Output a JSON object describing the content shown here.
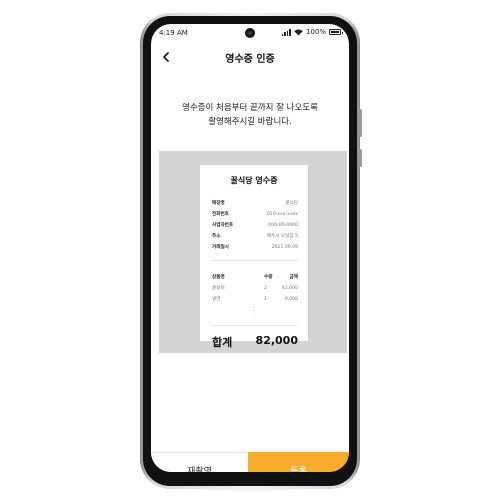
{
  "status_bar": {
    "time": "4:19 AM",
    "battery": "100%"
  },
  "header": {
    "title": "영수증 인증"
  },
  "instruction": {
    "line1": "영수증이 처음부터 끝까지 잘 나오도록",
    "line2": "촬영해주시길 바랍니다."
  },
  "receipt": {
    "title": "꿀식당 영수증",
    "info": [
      {
        "label": "매장명",
        "value": "꿀식당"
      },
      {
        "label": "전화번호",
        "value": "010-xxx-xxxx"
      },
      {
        "label": "사업자번호",
        "value": "000-00-0000"
      },
      {
        "label": "주소",
        "value": "제주시 오일장 5"
      },
      {
        "label": "거래일시",
        "value": "2021.09.09"
      }
    ],
    "columns": [
      "상품명",
      "수량",
      "금액"
    ],
    "items": [
      {
        "name": "꿀갈비",
        "qty": "2",
        "price": "42,000"
      },
      {
        "name": "냉면",
        "qty": "1",
        "price": "9,000"
      }
    ],
    "total_label": "합계",
    "total_value": "82,000"
  },
  "actions": {
    "retake_label": "재촬영",
    "register_label": "등록"
  },
  "colors": {
    "accent": "#f7ac2b",
    "photo_background": "#d4d4d4"
  }
}
